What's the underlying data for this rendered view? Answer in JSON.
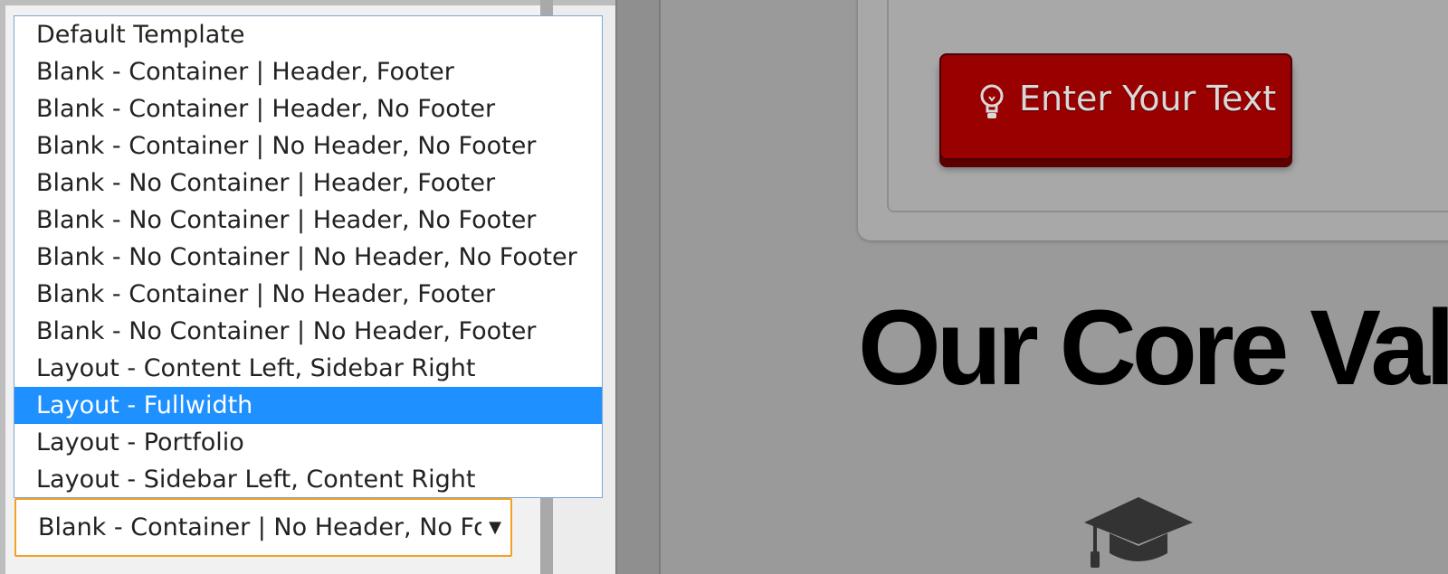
{
  "dropdown": {
    "options": [
      "Default Template",
      "Blank - Container | Header, Footer",
      "Blank - Container | Header, No Footer",
      "Blank - Container | No Header, No Footer",
      "Blank - No Container | Header, Footer",
      "Blank - No Container | Header, No Footer",
      "Blank - No Container | No Header, No Footer",
      "Blank - Container | No Header, Footer",
      "Blank - No Container | No Header, Footer",
      "Layout - Content Left, Sidebar Right",
      "Layout - Fullwidth",
      "Layout - Portfolio",
      "Layout - Sidebar Left, Content Right"
    ],
    "highlighted_option": "Layout - Fullwidth",
    "select_value": "Blank - Container | No Header, No Footer",
    "arrow_icon": "triangle-down-icon"
  },
  "preview": {
    "cta_label": "Enter Your Text",
    "cta_icon": "lightbulb-icon",
    "heading": "Our Core Valu",
    "section_icon": "graduation-cap-icon"
  },
  "colors": {
    "highlight": "#1e90ff",
    "select_border": "#f5a023",
    "cta_background": "#990000"
  }
}
